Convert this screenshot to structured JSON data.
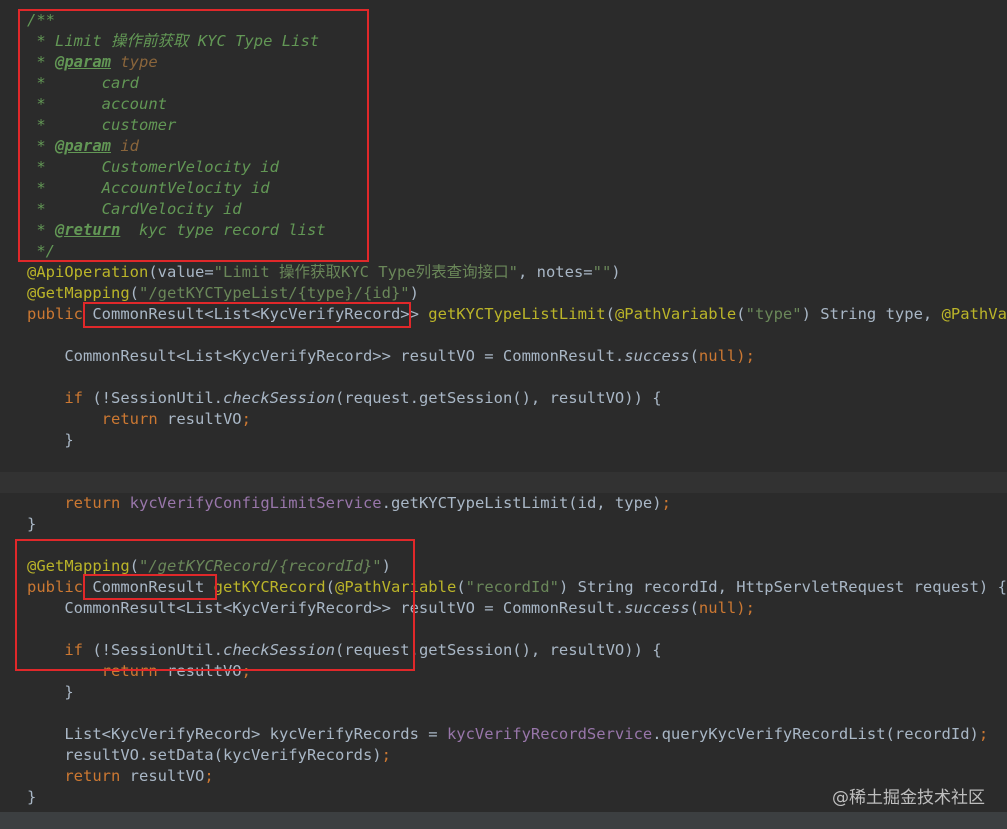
{
  "editor": {
    "lines": [
      [
        {
          "t": "/**",
          "c": "doc"
        }
      ],
      [
        {
          "t": " * Limit 操作前获取 KYC Type List",
          "c": "doc"
        }
      ],
      [
        {
          "t": " * ",
          "c": "doc"
        },
        {
          "t": "@param",
          "c": "doctag"
        },
        {
          "t": " type",
          "c": "docval"
        }
      ],
      [
        {
          "t": " *      card",
          "c": "doc"
        }
      ],
      [
        {
          "t": " *      account",
          "c": "doc"
        }
      ],
      [
        {
          "t": " *      customer",
          "c": "doc"
        }
      ],
      [
        {
          "t": " * ",
          "c": "doc"
        },
        {
          "t": "@param",
          "c": "doctag"
        },
        {
          "t": " id",
          "c": "docval"
        }
      ],
      [
        {
          "t": " *      CustomerVelocity id",
          "c": "doc"
        }
      ],
      [
        {
          "t": " *      AccountVelocity id",
          "c": "doc"
        }
      ],
      [
        {
          "t": " *      CardVelocity id",
          "c": "doc"
        }
      ],
      [
        {
          "t": " * ",
          "c": "doc"
        },
        {
          "t": "@return",
          "c": "doctag"
        },
        {
          "t": "  kyc type record list",
          "c": "doc"
        }
      ],
      [
        {
          "t": " */",
          "c": "doc"
        }
      ],
      [
        {
          "t": "@ApiOperation",
          "c": "ann"
        },
        {
          "t": "(value=",
          "c": "plain"
        },
        {
          "t": "\"Limit 操作获取KYC Type列表查询接口\"",
          "c": "str"
        },
        {
          "t": ", notes=",
          "c": "plain"
        },
        {
          "t": "\"\"",
          "c": "str"
        },
        {
          "t": ")",
          "c": "plain"
        }
      ],
      [
        {
          "t": "@GetMapping",
          "c": "ann"
        },
        {
          "t": "(",
          "c": "plain"
        },
        {
          "t": "\"/getKYCTypeList/{type}/{id}\"",
          "c": "str"
        },
        {
          "t": ")",
          "c": "plain"
        }
      ],
      [
        {
          "t": "public ",
          "c": "kw"
        },
        {
          "t": "CommonResult<List<KycVerifyRecord>> ",
          "c": "plain"
        },
        {
          "t": "getKYCTypeListLimit",
          "c": "ann"
        },
        {
          "t": "(",
          "c": "plain"
        },
        {
          "t": "@PathVariable",
          "c": "ann"
        },
        {
          "t": "(",
          "c": "plain"
        },
        {
          "t": "\"type\"",
          "c": "str"
        },
        {
          "t": ") String type, ",
          "c": "plain"
        },
        {
          "t": "@PathVariable",
          "c": "ann"
        }
      ],
      [],
      [
        {
          "t": "    CommonResult<List<KycVerifyRecord>> resultVO = CommonResult.",
          "c": "plain"
        },
        {
          "t": "success",
          "c": "static-i"
        },
        {
          "t": "(",
          "c": "plain"
        },
        {
          "t": "null",
          "c": "kw"
        },
        {
          "t": ");",
          "c": "punc"
        }
      ],
      [],
      [
        {
          "t": "    ",
          "c": "plain"
        },
        {
          "t": "if",
          "c": "kw"
        },
        {
          "t": " (!SessionUtil.",
          "c": "plain"
        },
        {
          "t": "checkSession",
          "c": "static-i"
        },
        {
          "t": "(request.getSession(), resultVO)) {",
          "c": "plain"
        }
      ],
      [
        {
          "t": "        ",
          "c": "plain"
        },
        {
          "t": "return",
          "c": "kw"
        },
        {
          "t": " resultVO",
          "c": "plain"
        },
        {
          "t": ";",
          "c": "punc"
        }
      ],
      [
        {
          "t": "    }",
          "c": "plain"
        }
      ],
      [],
      [],
      [
        {
          "t": "    ",
          "c": "plain"
        },
        {
          "t": "return",
          "c": "kw"
        },
        {
          "t": " ",
          "c": "plain"
        },
        {
          "t": "kycVerifyConfigLimitService",
          "c": "field"
        },
        {
          "t": ".getKYCTypeListLimit(id, type)",
          "c": "plain"
        },
        {
          "t": ";",
          "c": "punc"
        }
      ],
      [
        {
          "t": "}",
          "c": "plain"
        }
      ],
      [],
      [
        {
          "t": "@GetMapping",
          "c": "ann"
        },
        {
          "t": "(",
          "c": "plain"
        },
        {
          "t": "\"/getKYCRecord/{recordId}\"",
          "c": "str-i"
        },
        {
          "t": ")",
          "c": "plain"
        }
      ],
      [
        {
          "t": "public ",
          "c": "kw"
        },
        {
          "t": "CommonResult ",
          "c": "plain"
        },
        {
          "t": "getKYCRecord",
          "c": "ann"
        },
        {
          "t": "(",
          "c": "plain"
        },
        {
          "t": "@PathVariable",
          "c": "ann"
        },
        {
          "t": "(",
          "c": "plain"
        },
        {
          "t": "\"recordId\"",
          "c": "str"
        },
        {
          "t": ") String recordId, HttpServletRequest request) {",
          "c": "plain"
        }
      ],
      [
        {
          "t": "    CommonResult<List<KycVerifyRecord>> resultVO = CommonResult.",
          "c": "plain"
        },
        {
          "t": "success",
          "c": "static-i"
        },
        {
          "t": "(",
          "c": "plain"
        },
        {
          "t": "null",
          "c": "kw"
        },
        {
          "t": ");",
          "c": "punc"
        }
      ],
      [],
      [
        {
          "t": "    ",
          "c": "plain"
        },
        {
          "t": "if",
          "c": "kw"
        },
        {
          "t": " (!SessionUtil.",
          "c": "plain"
        },
        {
          "t": "checkSession",
          "c": "static-i"
        },
        {
          "t": "(request.getSession(), resultVO)) {",
          "c": "plain"
        }
      ],
      [
        {
          "t": "        ",
          "c": "plain"
        },
        {
          "t": "return",
          "c": "kw"
        },
        {
          "t": " resultVO",
          "c": "plain"
        },
        {
          "t": ";",
          "c": "punc"
        }
      ],
      [
        {
          "t": "    }",
          "c": "plain"
        }
      ],
      [],
      [
        {
          "t": "    List<KycVerifyRecord> kycVerifyRecords = ",
          "c": "plain"
        },
        {
          "t": "kycVerifyRecordService",
          "c": "field"
        },
        {
          "t": ".queryKycVerifyRecordList(recordId)",
          "c": "plain"
        },
        {
          "t": ";",
          "c": "punc"
        }
      ],
      [
        {
          "t": "    resultVO.setData(kycVerifyRecords)",
          "c": "plain"
        },
        {
          "t": ";",
          "c": "punc"
        }
      ],
      [
        {
          "t": "    ",
          "c": "plain"
        },
        {
          "t": "return",
          "c": "kw"
        },
        {
          "t": " resultVO",
          "c": "plain"
        },
        {
          "t": ";",
          "c": "punc"
        }
      ],
      [
        {
          "t": "}",
          "c": "plain"
        }
      ]
    ],
    "caret_line_index": 22
  },
  "watermark": "@稀土掘金技术社区"
}
